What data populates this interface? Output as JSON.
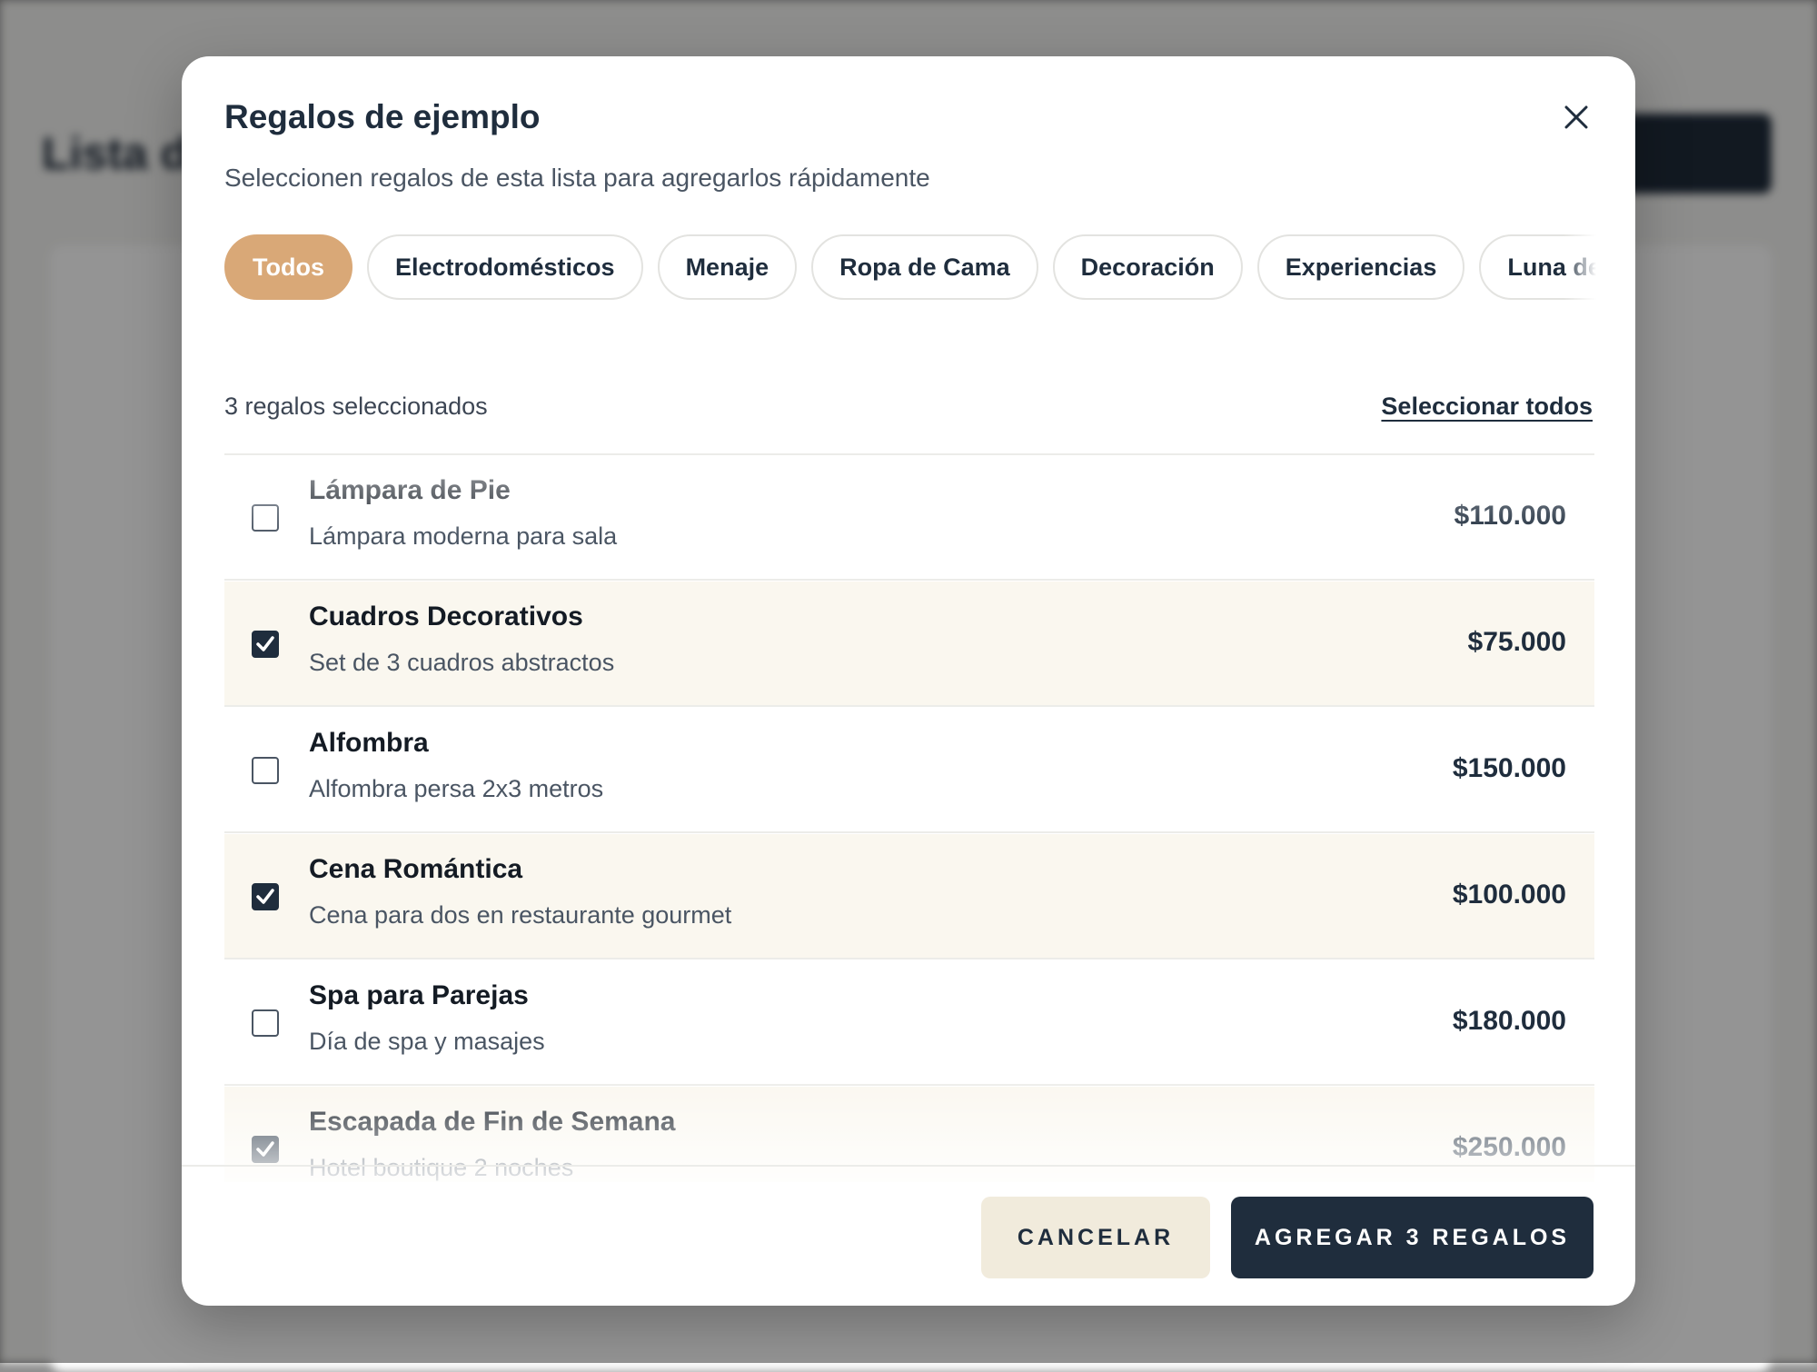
{
  "background": {
    "title": "Lista d"
  },
  "modal": {
    "title": "Regalos de ejemplo",
    "subtitle": "Seleccionen regalos de esta lista para agregarlos rápidamente",
    "tabs": [
      {
        "label": "Todos",
        "active": true
      },
      {
        "label": "Electrodomésticos",
        "active": false
      },
      {
        "label": "Menaje",
        "active": false
      },
      {
        "label": "Ropa de Cama",
        "active": false
      },
      {
        "label": "Decoración",
        "active": false
      },
      {
        "label": "Experiencias",
        "active": false
      },
      {
        "label": "Luna de Miel",
        "active": false
      }
    ],
    "selected_count_text": "3 regalos seleccionados",
    "select_all_label": "Seleccionar todos",
    "items": [
      {
        "name": "Lámpara de Pie",
        "description": "Lámpara moderna para sala",
        "price": "$110.000",
        "checked": false
      },
      {
        "name": "Cuadros Decorativos",
        "description": "Set de 3 cuadros abstractos",
        "price": "$75.000",
        "checked": true
      },
      {
        "name": "Alfombra",
        "description": "Alfombra persa 2x3 metros",
        "price": "$150.000",
        "checked": false
      },
      {
        "name": "Cena Romántica",
        "description": "Cena para dos en restaurante gourmet",
        "price": "$100.000",
        "checked": true
      },
      {
        "name": "Spa para Parejas",
        "description": "Día de spa y masajes",
        "price": "$180.000",
        "checked": false
      },
      {
        "name": "Escapada de Fin de Semana",
        "description": "Hotel boutique 2 noches",
        "price": "$250.000",
        "checked": true
      }
    ],
    "cancel_label": "CANCELAR",
    "add_label": "AGREGAR 3 REGALOS",
    "close_icon": "close-icon",
    "colors": {
      "accent": "#d9a877",
      "primary": "#1f2d3d",
      "selected_row": "#faf7ef",
      "cancel_bg": "#f1ebdc"
    }
  }
}
